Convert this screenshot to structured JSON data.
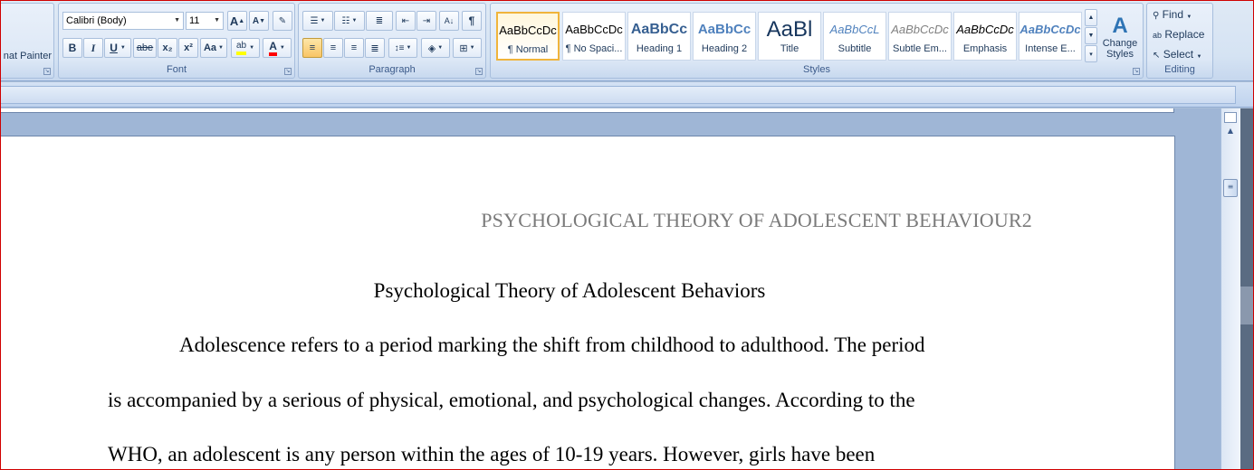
{
  "clipboard": {
    "format_painter_label": "nat Painter"
  },
  "font": {
    "group_label": "Font",
    "family_value": "Calibri (Body)",
    "size_value": "11",
    "grow_label": "A",
    "shrink_label": "A",
    "bold_label": "B",
    "italic_label": "I",
    "underline_label": "U",
    "strikethrough_label": "abe",
    "subscript_label": "x₂",
    "superscript_label": "x²",
    "change_case_label": "Aa",
    "font_color_label": "A",
    "highlight_color": "#ffff00",
    "font_color": "#ff0000"
  },
  "paragraph": {
    "group_label": "Paragraph",
    "show_marks_label": "¶"
  },
  "styles": {
    "group_label": "Styles",
    "tiles": [
      {
        "sample": "AaBbCcDc",
        "name": "¶ Normal"
      },
      {
        "sample": "AaBbCcDc",
        "name": "¶ No Spaci..."
      },
      {
        "sample": "AaBbCc",
        "name": "Heading 1"
      },
      {
        "sample": "AaBbCc",
        "name": "Heading 2"
      },
      {
        "sample": "AaBl",
        "name": "Title"
      },
      {
        "sample": "AaBbCcL",
        "name": "Subtitle"
      },
      {
        "sample": "AaBbCcDc",
        "name": "Subtle Em..."
      },
      {
        "sample": "AaBbCcDc",
        "name": "Emphasis"
      },
      {
        "sample": "AaBbCcDc",
        "name": "Intense E..."
      }
    ],
    "change_styles_label_1": "Change",
    "change_styles_label_2": "Styles"
  },
  "editing": {
    "group_label": "Editing",
    "find_label": "Find",
    "replace_label": "Replace",
    "select_label": "Select"
  },
  "document": {
    "header": "PSYCHOLOGICAL THEORY OF ADOLESCENT BEHAVIOUR2",
    "title": "Psychological Theory of Adolescent Behaviors",
    "line1": "Adolescence refers to a period marking the shift from childhood to adulthood. The period",
    "line2": "is accompanied by a serious of physical, emotional, and psychological changes. According to the",
    "line3": "WHO, an adolescent is any person within the ages of 10-19 years. However, girls have been"
  }
}
